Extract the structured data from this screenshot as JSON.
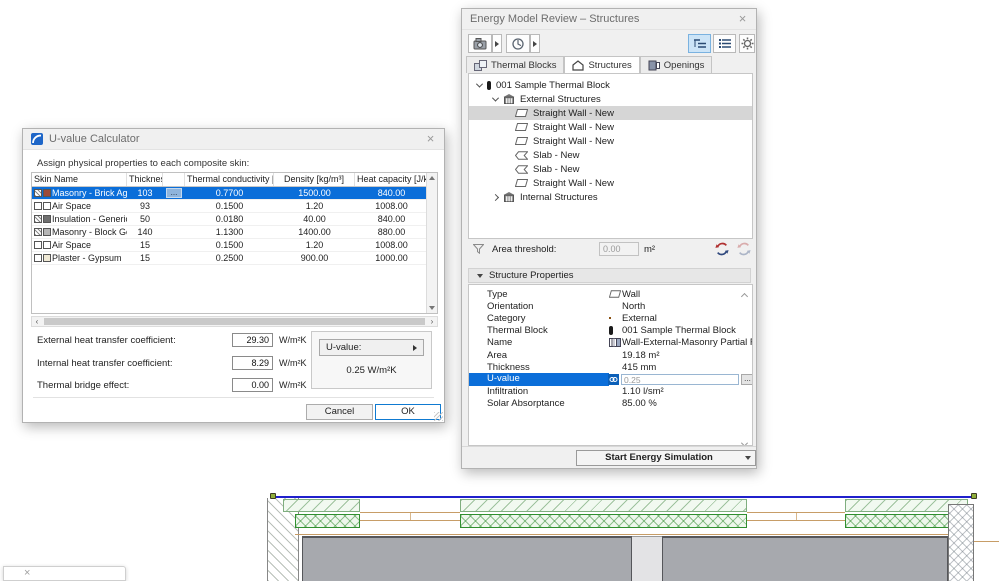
{
  "uvalue_dialog": {
    "title": "U-value Calculator",
    "close_label": "×",
    "instruction": "Assign physical properties to each composite skin:",
    "table": {
      "headers": {
        "skin_name": "Skin Name",
        "thickness": "Thickness",
        "conductivity": "Thermal conductivity [W/m...",
        "density": "Density [kg/m³]",
        "heat_capacity": "Heat capacity [J/kgK]"
      },
      "rows": [
        {
          "name": "Masonry - Brick Aged",
          "thickness": "103",
          "browse": "...",
          "conductivity": "0.7700",
          "density": "1500.00",
          "heat_capacity": "840.00",
          "swatch_style": "background:#9c4a38"
        },
        {
          "name": "Air Space",
          "thickness": "93",
          "conductivity": "0.1500",
          "density": "1.20",
          "heat_capacity": "1008.00",
          "swatch_style": "background:#ffffff"
        },
        {
          "name": "Insulation - Generic ...",
          "thickness": "50",
          "conductivity": "0.0180",
          "density": "40.00",
          "heat_capacity": "840.00",
          "swatch_style": "background:#6f6f6f"
        },
        {
          "name": "Masonry - Block Gen...",
          "thickness": "140",
          "conductivity": "1.1300",
          "density": "1400.00",
          "heat_capacity": "880.00",
          "swatch_style": "background:#b5b5b5"
        },
        {
          "name": "Air Space",
          "thickness": "15",
          "conductivity": "0.1500",
          "density": "1.20",
          "heat_capacity": "1008.00",
          "swatch_style": "background:#ffffff"
        },
        {
          "name": "Plaster - Gypsum",
          "thickness": "15",
          "conductivity": "0.2500",
          "density": "900.00",
          "heat_capacity": "1000.00",
          "swatch_style": "background:#f0ead6"
        }
      ]
    },
    "coefficients": [
      {
        "label": "External heat transfer coefficient:",
        "value": "29.30",
        "unit": "W/m²K"
      },
      {
        "label": "Internal heat transfer coefficient:",
        "value": "8.29",
        "unit": "W/m²K"
      },
      {
        "label": "Thermal bridge effect:",
        "value": "0.00",
        "unit": "W/m²K"
      }
    ],
    "uvalue_box": {
      "button_label": "U-value:",
      "result": "0.25 W/m²K"
    },
    "cancel_label": "Cancel",
    "ok_label": "OK"
  },
  "energy_dialog": {
    "title": "Energy Model Review – Structures",
    "close_label": "×",
    "tabs": {
      "thermal_blocks": "Thermal Blocks",
      "structures": "Structures",
      "openings": "Openings"
    },
    "tree": [
      {
        "label": "001 Sample Thermal Block"
      },
      {
        "label": "External Structures"
      },
      {
        "label": "Straight Wall - New"
      },
      {
        "label": "Straight Wall - New"
      },
      {
        "label": "Straight Wall - New"
      },
      {
        "label": "Slab - New"
      },
      {
        "label": "Slab - New"
      },
      {
        "label": "Straight Wall - New"
      },
      {
        "label": "Internal Structures"
      }
    ],
    "area_threshold": {
      "label": "Area threshold:",
      "value": "0.00",
      "unit": "m²"
    },
    "section_title": "Structure Properties",
    "properties": [
      {
        "label": "Type",
        "value": "Wall"
      },
      {
        "label": "Orientation",
        "value": "North"
      },
      {
        "label": "Category",
        "value": "External",
        "swatch_style": "background:#e8821e;border:1px solid #8a5010"
      },
      {
        "label": "Thermal Block",
        "value": "001 Sample Thermal Block"
      },
      {
        "label": "Name",
        "value": "Wall-External-Masonry Partial Fill"
      },
      {
        "label": "Area",
        "value": "19.18 m²"
      },
      {
        "label": "Thickness",
        "value": "415 mm"
      },
      {
        "label": "U-value",
        "value": "0.25",
        "browse": "..."
      },
      {
        "label": "Infiltration",
        "value": "1.10 l/sm²"
      },
      {
        "label": "Solar Absorptance",
        "value": "85.00 %"
      }
    ],
    "start_button_label": "Start Energy Simulation"
  },
  "mini_palette": {
    "close_label": "×"
  },
  "colors": {
    "accent": "#0b6ed9",
    "tree_selection": "#d6d6d6",
    "category_orange": "#e8821e",
    "drawing_blue": "#2020cc",
    "hatch_green": "#2f8f2f"
  }
}
